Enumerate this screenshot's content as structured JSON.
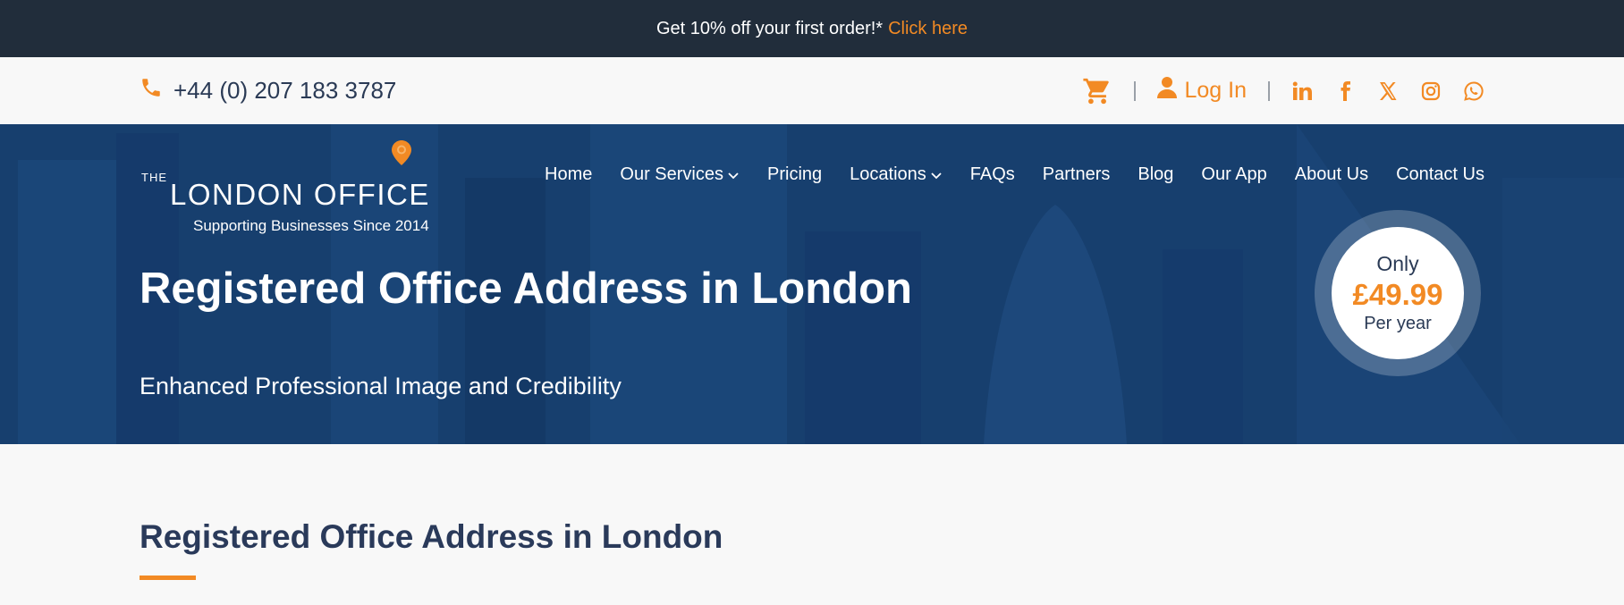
{
  "promo": {
    "text": "Get 10% off your first order!*",
    "link_label": "Click here"
  },
  "topbar": {
    "phone": "+44 (0) 207 183 3787",
    "login_label": "Log In",
    "icons": [
      "phone-icon",
      "cart-icon",
      "user-icon",
      "linkedin-icon",
      "facebook-icon",
      "x-icon",
      "instagram-icon",
      "whatsapp-icon"
    ]
  },
  "logo": {
    "the": "THE",
    "name": "LONDON OFFICE",
    "tagline": "Supporting Businesses Since 2014"
  },
  "nav": {
    "items": [
      {
        "label": "Home"
      },
      {
        "label": "Our Services"
      },
      {
        "label": "Pricing"
      },
      {
        "label": "Locations"
      },
      {
        "label": "FAQs"
      },
      {
        "label": "Partners"
      },
      {
        "label": "Blog"
      },
      {
        "label": "Our App"
      },
      {
        "label": "About Us"
      },
      {
        "label": "Contact Us"
      }
    ]
  },
  "hero": {
    "title": "Registered Office Address in London",
    "subtitle": "Enhanced Professional Image and Credibility"
  },
  "price_badge": {
    "top": "Only",
    "amount": "£49.99",
    "bottom": "Per year"
  },
  "section": {
    "title": "Registered Office Address in London"
  },
  "colors": {
    "accent": "#f28a24",
    "dark_bar": "#212d3b",
    "hero_blue": "#163f6f",
    "heading_navy": "#2a3a5a"
  }
}
